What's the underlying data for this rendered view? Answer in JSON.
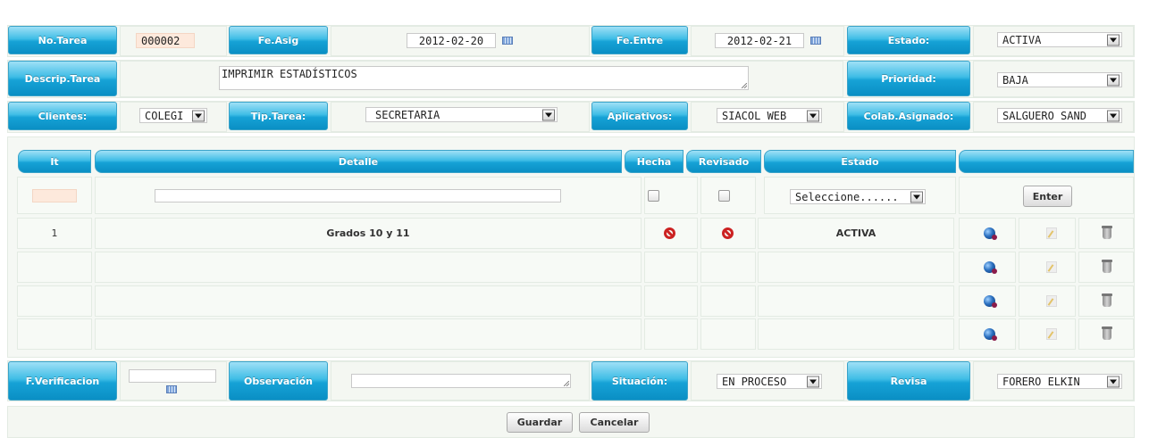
{
  "header": {
    "no_tarea_label": "No.Tarea",
    "no_tarea_value": "000002",
    "fe_asig_label": "Fe.Asig",
    "fe_asig_value": "2012-02-20",
    "fe_entre_label": "Fe.Entre",
    "fe_entre_value": "2012-02-21",
    "estado_label": "Estado:",
    "estado_value": "ACTIVA",
    "descrip_label": "Descrip.Tarea",
    "descrip_value": "IMPRIMIR ESTADÍSTICOS",
    "prioridad_label": "Prioridad:",
    "prioridad_value": "BAJA",
    "clientes_label": "Clientes:",
    "clientes_value": "COLEGI",
    "tip_tarea_label": "Tip.Tarea:",
    "tip_tarea_value": "SECRETARIA",
    "aplicativos_label": "Aplicativos:",
    "aplicativos_value": "SIACOL WEB",
    "colab_label": "Colab.Asignado:",
    "colab_value": "SALGUERO SAND"
  },
  "grid": {
    "columns": [
      "It",
      "Detalle",
      "Hecha",
      "Revisado",
      "Estado",
      ""
    ],
    "estado_select": "Seleccione......",
    "enter_button": "Enter",
    "rows": [
      {
        "it": "1",
        "detalle": "Grados 10 y 11",
        "estado": "ACTIVA"
      },
      {
        "it": "",
        "detalle": "",
        "estado": ""
      },
      {
        "it": "",
        "detalle": "",
        "estado": ""
      },
      {
        "it": "",
        "detalle": "",
        "estado": ""
      }
    ]
  },
  "footer": {
    "verificacion_label": "F.Verificacion",
    "observacion_label": "Observación",
    "situacion_label": "Situación:",
    "situacion_value": "EN PROCESO",
    "revisa_label": "Revisa",
    "revisa_value": "FORERO ELKIN",
    "guardar_button": "Guardar",
    "cancelar_button": "Cancelar"
  },
  "icons": {
    "no_symbol": "no-entry-icon",
    "view": "globe-view-icon",
    "edit": "edit-icon",
    "delete": "trash-icon",
    "calendar": "calendar-icon",
    "dropdown": "chevron-down-icon"
  },
  "colors": {
    "header_blue": "#16a2d6",
    "cell_bg": "#f4f7f2",
    "no_red": "#cc2222",
    "id_field": "#fde9dc"
  }
}
